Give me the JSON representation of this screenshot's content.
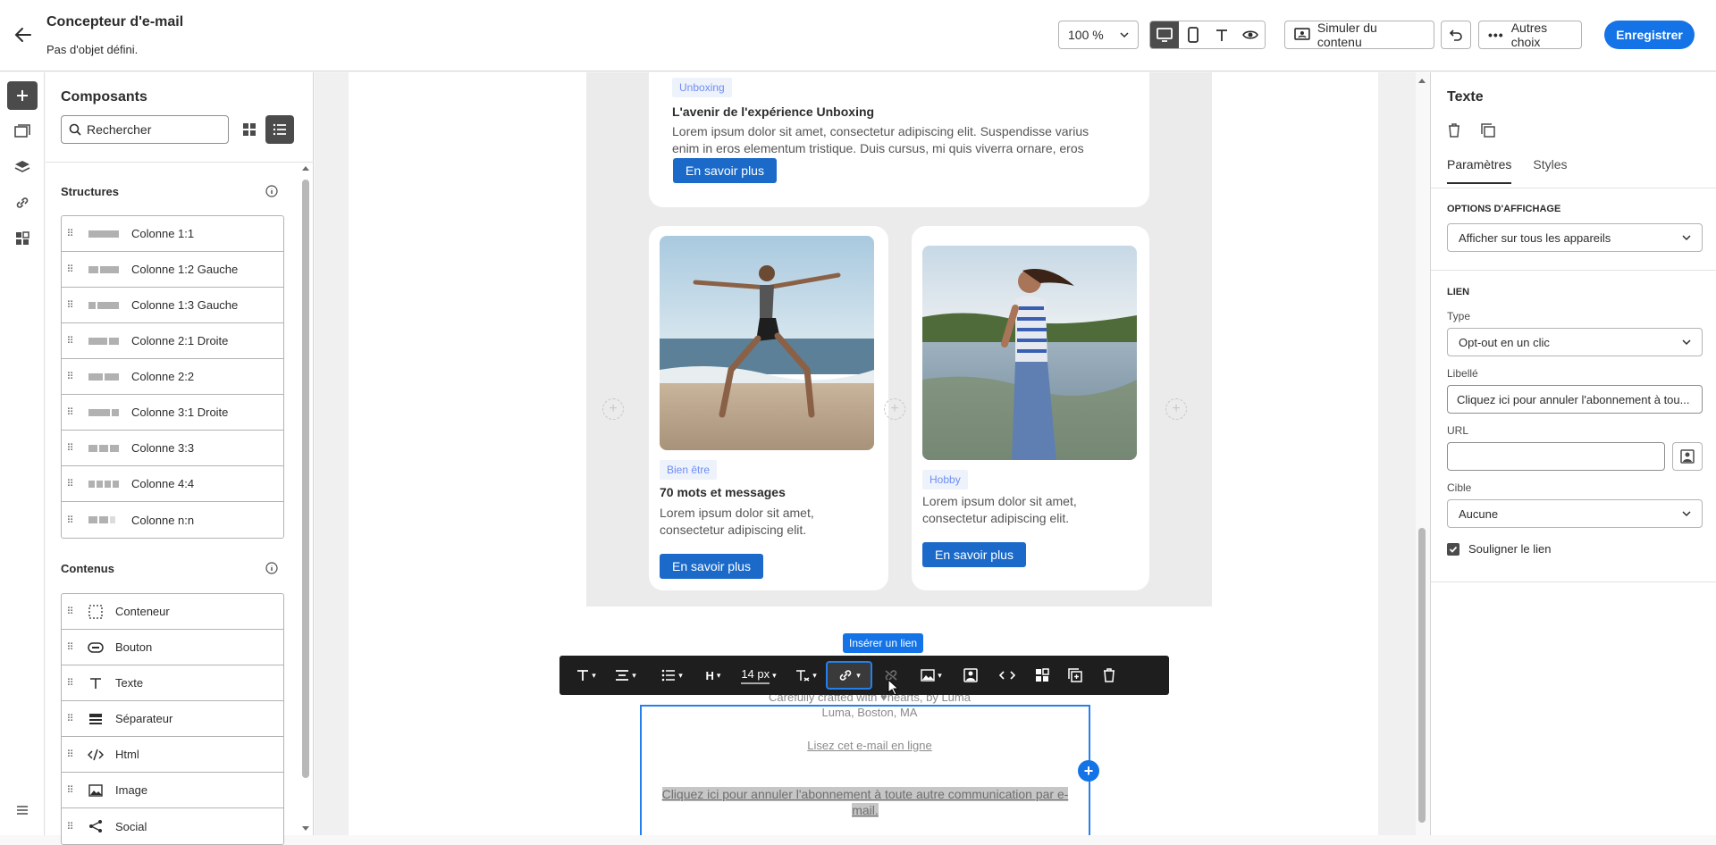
{
  "header": {
    "title": "Concepteur d'e-mail",
    "subtitle": "Pas d'objet défini.",
    "zoom": "100 %",
    "simulate_label": "Simuler du contenu",
    "more_label": "Autres choix",
    "save_label": "Enregistrer"
  },
  "components": {
    "title": "Composants",
    "search_placeholder": "Rechercher",
    "structures_title": "Structures",
    "structures": [
      {
        "label": "Colonne 1:1"
      },
      {
        "label": "Colonne 1:2 Gauche"
      },
      {
        "label": "Colonne 1:3 Gauche"
      },
      {
        "label": "Colonne 2:1 Droite"
      },
      {
        "label": "Colonne 2:2"
      },
      {
        "label": "Colonne 3:1 Droite"
      },
      {
        "label": "Colonne 3:3"
      },
      {
        "label": "Colonne 4:4"
      },
      {
        "label": "Colonne n:n"
      }
    ],
    "contents_title": "Contenus",
    "contents": [
      {
        "label": "Conteneur",
        "icon": "container-icon"
      },
      {
        "label": "Bouton",
        "icon": "button-icon"
      },
      {
        "label": "Texte",
        "icon": "text-icon"
      },
      {
        "label": "Séparateur",
        "icon": "divider-icon"
      },
      {
        "label": "Html",
        "icon": "code-icon"
      },
      {
        "label": "Image",
        "icon": "image-icon"
      },
      {
        "label": "Social",
        "icon": "share-icon"
      }
    ]
  },
  "email": {
    "card1": {
      "tag": "Unboxing",
      "title": "L'avenir de l'expérience Unboxing",
      "text": "Lorem ipsum dolor sit amet, consectetur adipiscing elit. Suspendisse varius enim in eros elementum tristique. Duis cursus, mi quis viverra ornare, eros",
      "cta": "En savoir plus"
    },
    "card2": {
      "tag": "Bien être",
      "title": "70 mots et messages",
      "text": "Lorem ipsum dolor sit amet, consectetur adipiscing elit.",
      "cta": "En savoir plus"
    },
    "card3": {
      "tag": "Hobby",
      "text": "Lorem ipsum dolor sit amet, consectetur adipiscing elit.",
      "cta": "En savoir plus"
    },
    "footer_line1": "Carefully crafted with ♥hearts, by Luma",
    "footer_line2": "Luma, Boston, MA",
    "read_online": "Lisez cet e-mail en ligne",
    "unsubscribe": "Cliquez ici pour annuler l'abonnement à toute autre communication par e-mail."
  },
  "toolbar": {
    "font_size": "14 px",
    "tooltip": "Insérer un lien"
  },
  "properties": {
    "title": "Texte",
    "tabs": [
      "Paramètres",
      "Styles"
    ],
    "display_section": "OPTIONS D'AFFICHAGE",
    "display_value": "Afficher sur tous les appareils",
    "link_section": "LIEN",
    "type_label": "Type",
    "type_value": "Opt-out en un clic",
    "label_label": "Libellé",
    "label_value": "Cliquez ici pour annuler l'abonnement à tou...",
    "url_label": "URL",
    "url_value": "",
    "target_label": "Cible",
    "target_value": "Aucune",
    "underline_label": "Souligner le lien"
  },
  "colors": {
    "accent": "#1473e6",
    "cta": "#1b6ac9",
    "toolbar": "#1e1e1e"
  }
}
